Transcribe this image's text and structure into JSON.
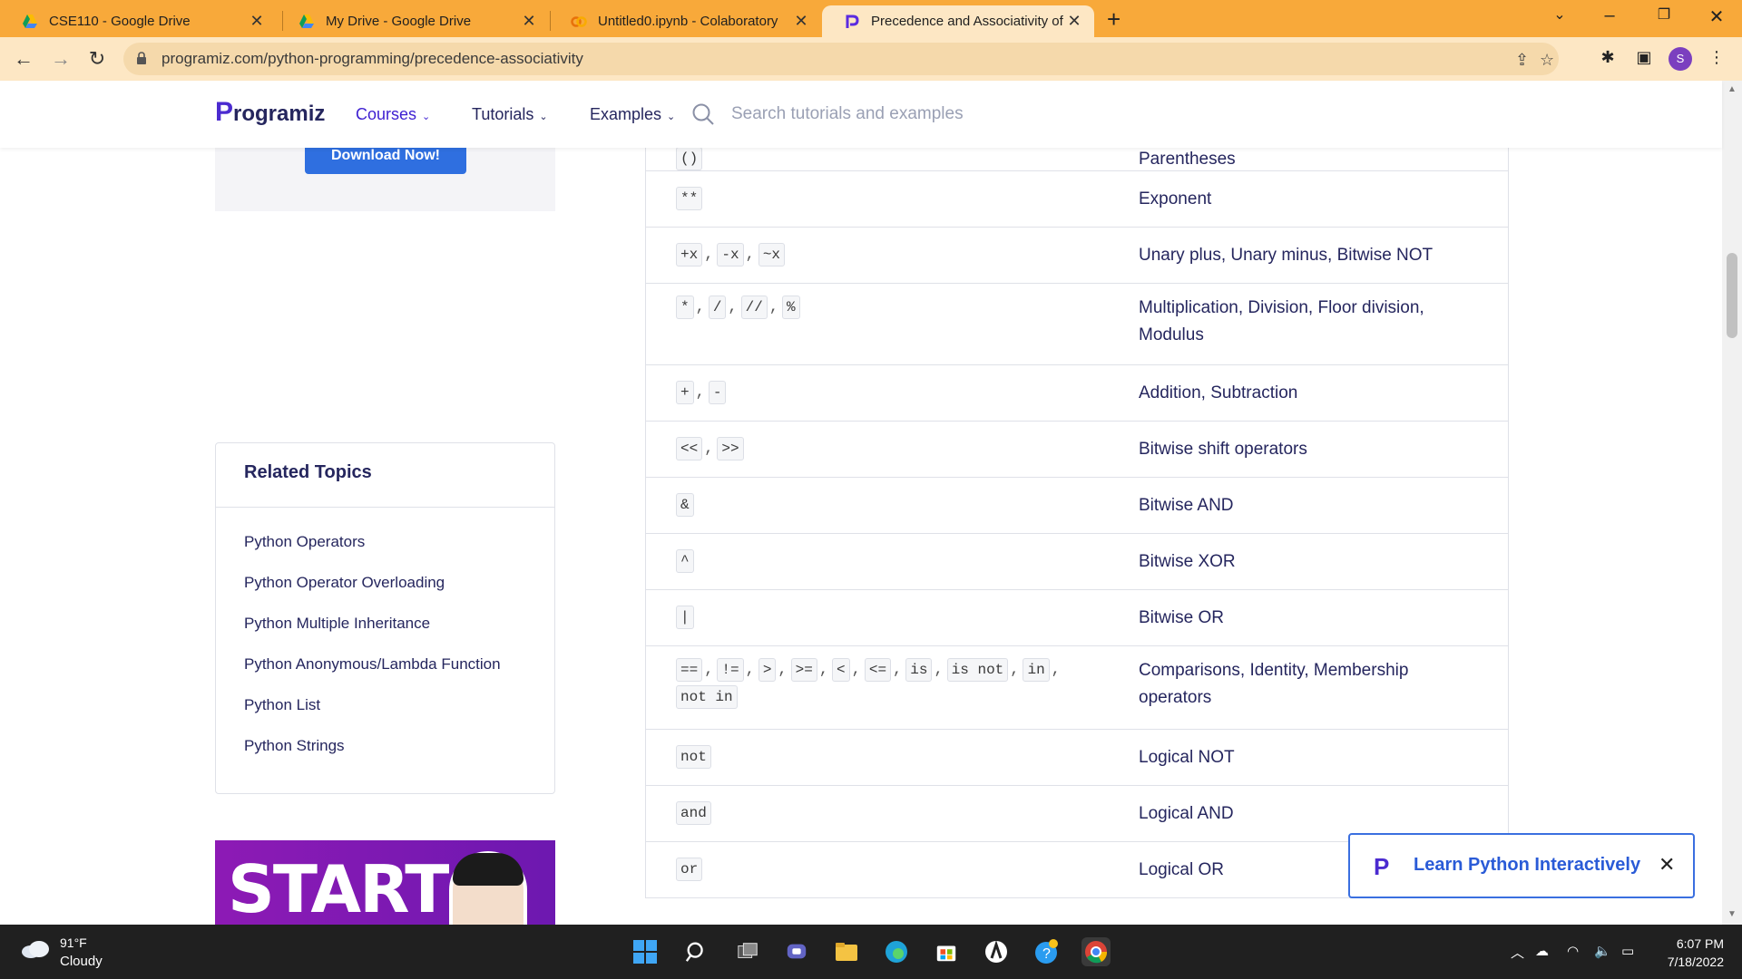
{
  "browser": {
    "tabs": [
      {
        "title": "CSE110 - Google Drive",
        "icon": "google-drive-icon"
      },
      {
        "title": "My Drive - Google Drive",
        "icon": "google-drive-icon"
      },
      {
        "title": "Untitled0.ipynb - Colaboratory",
        "icon": "colab-icon"
      },
      {
        "title": "Precedence and Associativity of O",
        "icon": "programiz-icon",
        "active": true
      }
    ],
    "url": "programiz.com/python-programming/precedence-associativity",
    "profile_initial": "S"
  },
  "site": {
    "logo_text": "rogramiz",
    "logo_p": "P",
    "nav": [
      {
        "label": "Courses"
      },
      {
        "label": "Tutorials"
      },
      {
        "label": "Examples"
      }
    ],
    "search_placeholder": "Search tutorials and examples"
  },
  "sidebar": {
    "download_button": "Download Now!",
    "related_title": "Related Topics",
    "related_items": [
      "Python Operators",
      "Python Operator Overloading",
      "Python Multiple Inheritance",
      "Python Anonymous/Lambda Function",
      "Python List",
      "Python Strings"
    ],
    "banner_text": "START"
  },
  "operators_table": {
    "rows": [
      {
        "ops": [
          "()"
        ],
        "desc": "Parentheses"
      },
      {
        "ops": [
          "**"
        ],
        "desc": "Exponent"
      },
      {
        "ops": [
          "+x",
          "-x",
          "~x"
        ],
        "desc": "Unary plus, Unary minus, Bitwise NOT"
      },
      {
        "ops": [
          "*",
          "/",
          "//",
          "%"
        ],
        "desc": "Multiplication, Division, Floor division, Modulus"
      },
      {
        "ops": [
          "+",
          "-"
        ],
        "desc": "Addition, Subtraction"
      },
      {
        "ops": [
          "<<",
          ">>"
        ],
        "desc": "Bitwise shift operators"
      },
      {
        "ops": [
          "&"
        ],
        "desc": "Bitwise AND"
      },
      {
        "ops": [
          "^"
        ],
        "desc": "Bitwise XOR"
      },
      {
        "ops": [
          "|"
        ],
        "desc": "Bitwise OR"
      },
      {
        "ops": [
          "==",
          "!=",
          ">",
          ">=",
          "<",
          "<=",
          "is",
          "is not",
          "in",
          "not in"
        ],
        "desc": "Comparisons, Identity, Membership operators"
      },
      {
        "ops": [
          "not"
        ],
        "desc": "Logical NOT"
      },
      {
        "ops": [
          "and"
        ],
        "desc": "Logical AND"
      },
      {
        "ops": [
          "or"
        ],
        "desc": "Logical OR"
      }
    ]
  },
  "toast": {
    "text": "Learn Python Interactively"
  },
  "taskbar": {
    "temperature": "91°F",
    "condition": "Cloudy",
    "time": "6:07 PM",
    "date": "7/18/2022"
  },
  "colors": {
    "tab_strip": "#f8a93a",
    "accent": "#3d1fd1",
    "button_blue": "#2f6fe0"
  }
}
